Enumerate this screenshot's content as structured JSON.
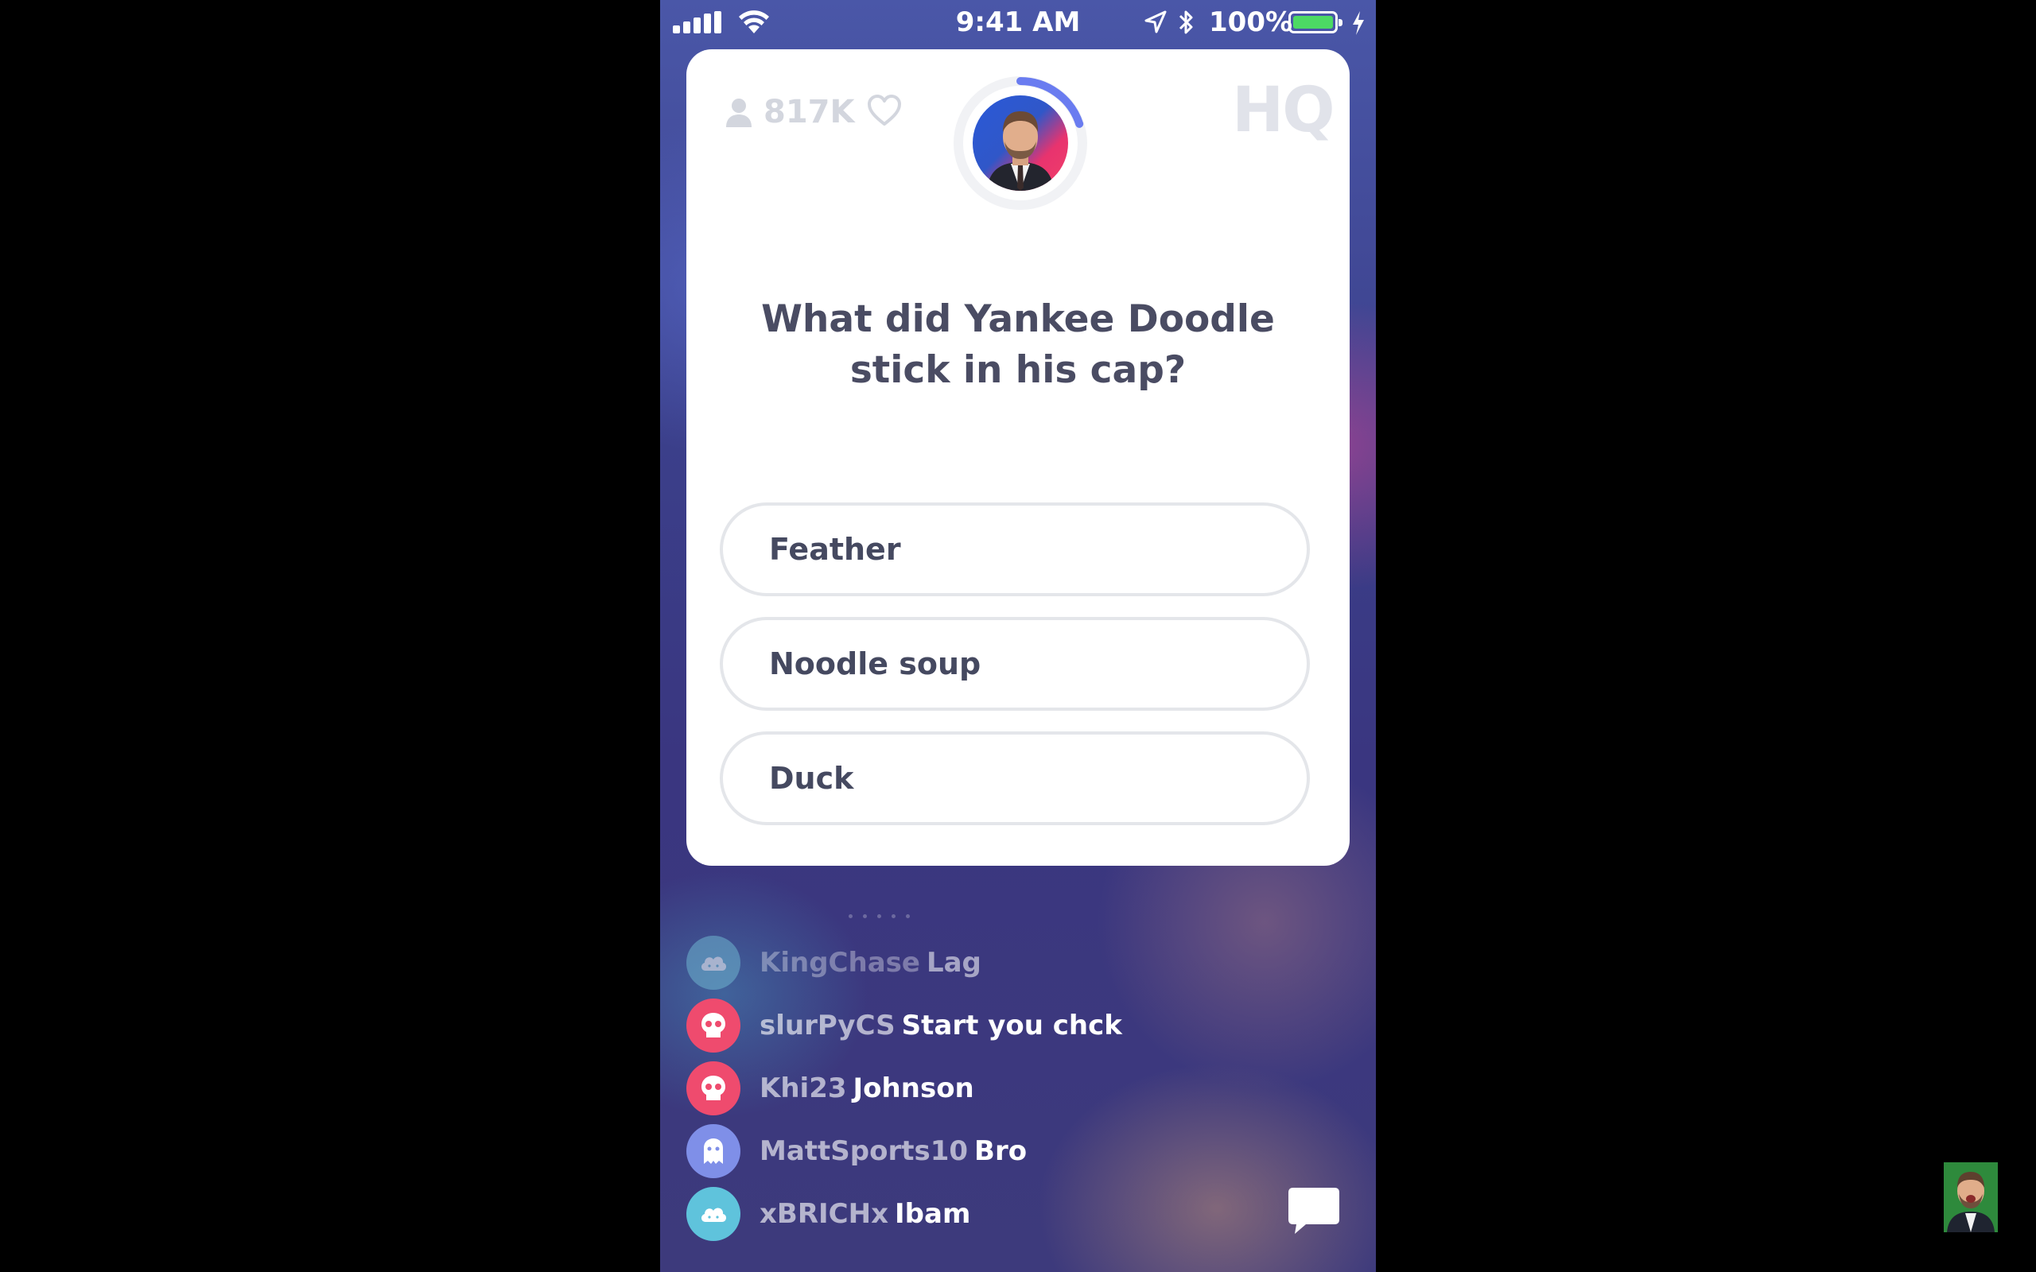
{
  "status_bar": {
    "time": "9:41 AM",
    "battery_percent": "100%",
    "colors": {
      "battery_fill": "#4cd964"
    }
  },
  "header": {
    "viewer_count": "817K",
    "logo": "HQ",
    "timer_progress": 0.2
  },
  "question": {
    "text": "What did Yankee Doodle stick in his cap?",
    "options": [
      "Feather",
      "Noodle soup",
      "Duck"
    ]
  },
  "chat": {
    "messages": [
      {
        "user": "KingChase",
        "text": "Lag",
        "icon": "cloud-icon",
        "color": "#6fb4cf"
      },
      {
        "user": "slurPyCS",
        "text": "Start you chck",
        "icon": "skull-icon",
        "color": "#ef4b6e"
      },
      {
        "user": "Khi23",
        "text": "Johnson",
        "icon": "skull-icon",
        "color": "#ef4b6e"
      },
      {
        "user": "MattSports10",
        "text": "Bro",
        "icon": "ghost-icon",
        "color": "#7f8fe8"
      },
      {
        "user": "xBRICHx",
        "text": "Ibam",
        "icon": "cloud-icon",
        "color": "#5fc3dc"
      }
    ]
  },
  "colors": {
    "card": "#ffffff",
    "question_text": "#4a4c63",
    "timer_arc": "#6a7cf0"
  }
}
